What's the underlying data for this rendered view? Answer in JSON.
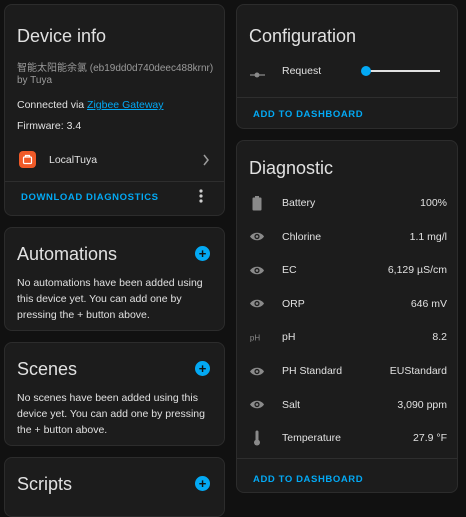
{
  "device_info": {
    "title": "Device info",
    "model": "智能太阳能余氯 (eb19dd0d740deec488krnr)",
    "manufacturer": "by Tuya",
    "connected_prefix": "Connected via ",
    "connected_link": "Zigbee Gateway",
    "firmware": "Firmware: 3.4",
    "integration": "LocalTuya",
    "download_label": "DOWNLOAD DIAGNOSTICS"
  },
  "automations": {
    "title": "Automations",
    "text": "No automations have been added using this device yet. You can add one by pressing the + button above."
  },
  "scenes": {
    "title": "Scenes",
    "text": "No scenes have been added using this device yet. You can add one by pressing the + button above."
  },
  "scripts": {
    "title": "Scripts"
  },
  "configuration": {
    "title": "Configuration",
    "entity": "Request",
    "slider_value": 0,
    "add_label": "ADD TO DASHBOARD"
  },
  "diagnostic": {
    "title": "Diagnostic",
    "rows": [
      {
        "icon": "battery-icon",
        "label": "Battery",
        "value": "100%"
      },
      {
        "icon": "eye-icon",
        "label": "Chlorine",
        "value": "1.1 mg/l"
      },
      {
        "icon": "eye-icon",
        "label": "EC",
        "value": "6,129 µS/cm"
      },
      {
        "icon": "eye-icon",
        "label": "ORP",
        "value": "646 mV"
      },
      {
        "icon": "ph-icon",
        "label": "pH",
        "value": "8.2"
      },
      {
        "icon": "eye-icon",
        "label": "PH Standard",
        "value": "EUStandard"
      },
      {
        "icon": "eye-icon",
        "label": "Salt",
        "value": "3,090 ppm"
      },
      {
        "icon": "thermometer-icon",
        "label": "Temperature",
        "value": "27.9 °F"
      }
    ],
    "add_label": "ADD TO DASHBOARD"
  },
  "colors": {
    "accent": "#03a9f4",
    "card_bg": "#1c1c1c",
    "page_bg": "#111111",
    "integration_logo": "#f05a28"
  }
}
